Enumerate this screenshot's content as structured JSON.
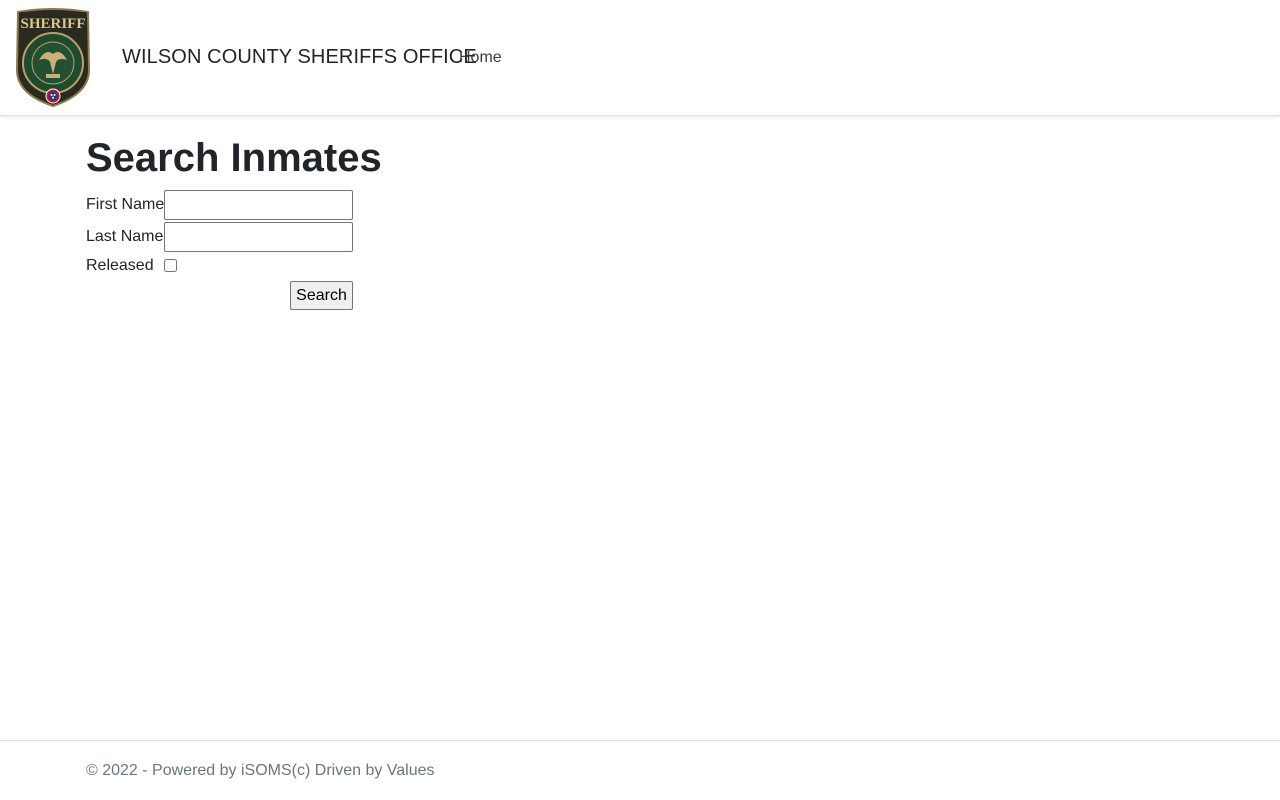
{
  "header": {
    "logo_icon": "sheriff-badge-icon",
    "brand": "WILSON COUNTY SHERIFFS OFFICE",
    "nav": [
      {
        "label": "Home"
      }
    ]
  },
  "main": {
    "title": "Search Inmates",
    "form": {
      "first_name_label": "First Name",
      "first_name_value": "",
      "last_name_label": "Last Name",
      "last_name_value": "",
      "released_label": "Released",
      "released_checked": false,
      "search_button": "Search"
    }
  },
  "footer": {
    "text": "© 2022 - Powered by iSOMS(c) Driven by Values"
  },
  "colors": {
    "badge_green": "#1f4a2e",
    "badge_gold": "#b8a26a",
    "footer_text": "#6c757d"
  }
}
